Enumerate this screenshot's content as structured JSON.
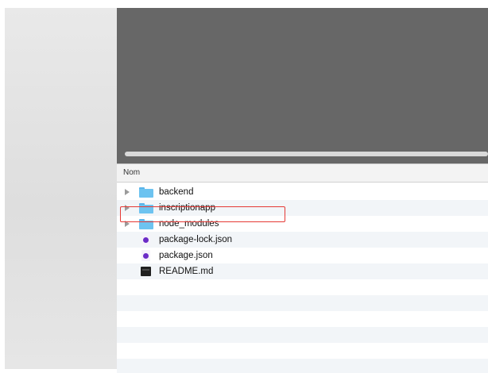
{
  "column_header": {
    "name_label": "Nom"
  },
  "files": [
    {
      "name": "backend",
      "type": "folder",
      "icon": "folder-icon"
    },
    {
      "name": "inscriptionapp",
      "type": "folder",
      "icon": "folder-icon",
      "highlighted": true
    },
    {
      "name": "node_modules",
      "type": "folder",
      "icon": "folder-icon"
    },
    {
      "name": "package-lock.json",
      "type": "file",
      "icon": "json-file-icon"
    },
    {
      "name": "package.json",
      "type": "file",
      "icon": "json-file-icon"
    },
    {
      "name": "README.md",
      "type": "file",
      "icon": "markdown-file-icon"
    }
  ],
  "colors": {
    "preview_background": "#676767",
    "folder": "#6dc3f0",
    "json_accent": "#6b2bc7",
    "highlight": "#e53935",
    "row_stripe": "#f2f5f8"
  }
}
